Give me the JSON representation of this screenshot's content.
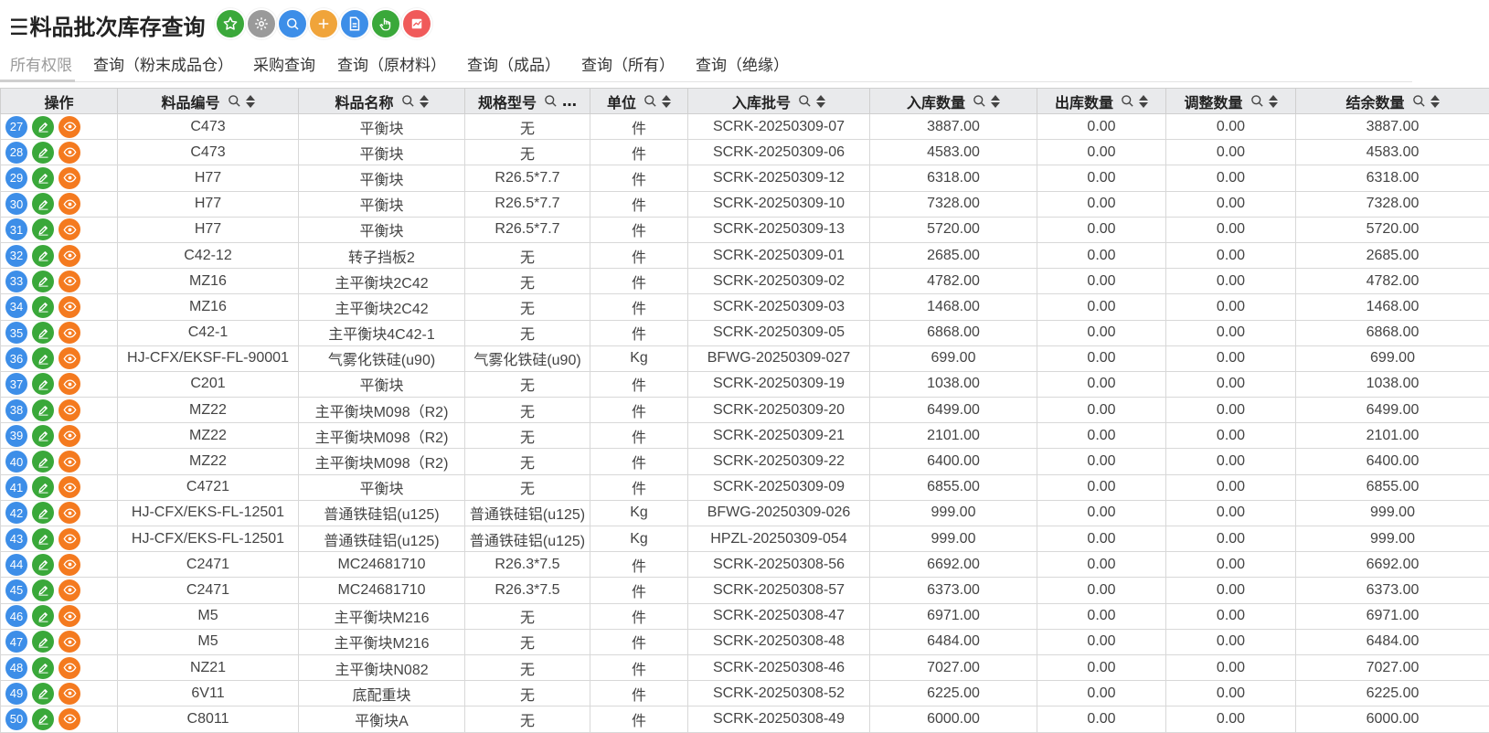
{
  "title": "料品批次库存查询",
  "toolbar": {
    "buttons": [
      {
        "name": "favorite",
        "icon": "star-icon",
        "color": "#3aa83a"
      },
      {
        "name": "settings",
        "icon": "gear-icon",
        "color": "#9a9a9a"
      },
      {
        "name": "search",
        "icon": "search-icon",
        "color": "#3d8ee8"
      },
      {
        "name": "add",
        "icon": "plus-icon",
        "color": "#f0a43a"
      },
      {
        "name": "document",
        "icon": "document-icon",
        "color": "#3d8ee8"
      },
      {
        "name": "touch",
        "icon": "hand-pointer-icon",
        "color": "#3aa83a"
      },
      {
        "name": "chart",
        "icon": "chart-icon",
        "color": "#f05a5a"
      }
    ]
  },
  "tabs": [
    {
      "label": "所有权限",
      "active": true
    },
    {
      "label": "查询（粉末成品仓）"
    },
    {
      "label": "采购查询"
    },
    {
      "label": "查询（原材料）"
    },
    {
      "label": "查询（成品）"
    },
    {
      "label": "查询（所有）"
    },
    {
      "label": "查询（绝缘）"
    }
  ],
  "table": {
    "columns": [
      "操作",
      "料品编号",
      "料品名称",
      "规格型号",
      "单位",
      "入库批号",
      "入库数量",
      "出库数量",
      "调整数量",
      "结余数量"
    ],
    "spec_header_ellipsis": "…",
    "rows": [
      {
        "no": "27",
        "code": "C473",
        "name": "平衡块",
        "spec": "无",
        "unit": "件",
        "batch": "SCRK-20250309-07",
        "in": "3887.00",
        "out": "0.00",
        "adj": "0.00",
        "bal": "3887.00"
      },
      {
        "no": "28",
        "code": "C473",
        "name": "平衡块",
        "spec": "无",
        "unit": "件",
        "batch": "SCRK-20250309-06",
        "in": "4583.00",
        "out": "0.00",
        "adj": "0.00",
        "bal": "4583.00"
      },
      {
        "no": "29",
        "code": "H77",
        "name": "平衡块",
        "spec": "R26.5*7.7",
        "unit": "件",
        "batch": "SCRK-20250309-12",
        "in": "6318.00",
        "out": "0.00",
        "adj": "0.00",
        "bal": "6318.00"
      },
      {
        "no": "30",
        "code": "H77",
        "name": "平衡块",
        "spec": "R26.5*7.7",
        "unit": "件",
        "batch": "SCRK-20250309-10",
        "in": "7328.00",
        "out": "0.00",
        "adj": "0.00",
        "bal": "7328.00"
      },
      {
        "no": "31",
        "code": "H77",
        "name": "平衡块",
        "spec": "R26.5*7.7",
        "unit": "件",
        "batch": "SCRK-20250309-13",
        "in": "5720.00",
        "out": "0.00",
        "adj": "0.00",
        "bal": "5720.00"
      },
      {
        "no": "32",
        "code": "C42-12",
        "name": "转子挡板2",
        "spec": "无",
        "unit": "件",
        "batch": "SCRK-20250309-01",
        "in": "2685.00",
        "out": "0.00",
        "adj": "0.00",
        "bal": "2685.00"
      },
      {
        "no": "33",
        "code": "MZ16",
        "name": "主平衡块2C42",
        "spec": "无",
        "unit": "件",
        "batch": "SCRK-20250309-02",
        "in": "4782.00",
        "out": "0.00",
        "adj": "0.00",
        "bal": "4782.00"
      },
      {
        "no": "34",
        "code": "MZ16",
        "name": "主平衡块2C42",
        "spec": "无",
        "unit": "件",
        "batch": "SCRK-20250309-03",
        "in": "1468.00",
        "out": "0.00",
        "adj": "0.00",
        "bal": "1468.00"
      },
      {
        "no": "35",
        "code": "C42-1",
        "name": "主平衡块4C42-1",
        "spec": "无",
        "unit": "件",
        "batch": "SCRK-20250309-05",
        "in": "6868.00",
        "out": "0.00",
        "adj": "0.00",
        "bal": "6868.00"
      },
      {
        "no": "36",
        "code": "HJ-CFX/EKSF-FL-90001",
        "name": "气雾化铁硅(u90)",
        "spec": "气雾化铁硅(u90)",
        "unit": "Kg",
        "batch": "BFWG-20250309-027",
        "in": "699.00",
        "out": "0.00",
        "adj": "0.00",
        "bal": "699.00"
      },
      {
        "no": "37",
        "code": "C201",
        "name": "平衡块",
        "spec": "无",
        "unit": "件",
        "batch": "SCRK-20250309-19",
        "in": "1038.00",
        "out": "0.00",
        "adj": "0.00",
        "bal": "1038.00"
      },
      {
        "no": "38",
        "code": "MZ22",
        "name": "主平衡块M098（R2)",
        "spec": "无",
        "unit": "件",
        "batch": "SCRK-20250309-20",
        "in": "6499.00",
        "out": "0.00",
        "adj": "0.00",
        "bal": "6499.00"
      },
      {
        "no": "39",
        "code": "MZ22",
        "name": "主平衡块M098（R2)",
        "spec": "无",
        "unit": "件",
        "batch": "SCRK-20250309-21",
        "in": "2101.00",
        "out": "0.00",
        "adj": "0.00",
        "bal": "2101.00"
      },
      {
        "no": "40",
        "code": "MZ22",
        "name": "主平衡块M098（R2)",
        "spec": "无",
        "unit": "件",
        "batch": "SCRK-20250309-22",
        "in": "6400.00",
        "out": "0.00",
        "adj": "0.00",
        "bal": "6400.00"
      },
      {
        "no": "41",
        "code": "C4721",
        "name": "平衡块",
        "spec": "无",
        "unit": "件",
        "batch": "SCRK-20250309-09",
        "in": "6855.00",
        "out": "0.00",
        "adj": "0.00",
        "bal": "6855.00"
      },
      {
        "no": "42",
        "code": "HJ-CFX/EKS-FL-12501",
        "name": "普通铁硅铝(u125)",
        "spec": "普通铁硅铝(u125)",
        "unit": "Kg",
        "batch": "BFWG-20250309-026",
        "in": "999.00",
        "out": "0.00",
        "adj": "0.00",
        "bal": "999.00"
      },
      {
        "no": "43",
        "code": "HJ-CFX/EKS-FL-12501",
        "name": "普通铁硅铝(u125)",
        "spec": "普通铁硅铝(u125)",
        "unit": "Kg",
        "batch": "HPZL-20250309-054",
        "in": "999.00",
        "out": "0.00",
        "adj": "0.00",
        "bal": "999.00"
      },
      {
        "no": "44",
        "code": "C2471",
        "name": "MC24681710",
        "spec": "R26.3*7.5",
        "unit": "件",
        "batch": "SCRK-20250308-56",
        "in": "6692.00",
        "out": "0.00",
        "adj": "0.00",
        "bal": "6692.00"
      },
      {
        "no": "45",
        "code": "C2471",
        "name": "MC24681710",
        "spec": "R26.3*7.5",
        "unit": "件",
        "batch": "SCRK-20250308-57",
        "in": "6373.00",
        "out": "0.00",
        "adj": "0.00",
        "bal": "6373.00"
      },
      {
        "no": "46",
        "code": "M5",
        "name": "主平衡块M216",
        "spec": "无",
        "unit": "件",
        "batch": "SCRK-20250308-47",
        "in": "6971.00",
        "out": "0.00",
        "adj": "0.00",
        "bal": "6971.00"
      },
      {
        "no": "47",
        "code": "M5",
        "name": "主平衡块M216",
        "spec": "无",
        "unit": "件",
        "batch": "SCRK-20250308-48",
        "in": "6484.00",
        "out": "0.00",
        "adj": "0.00",
        "bal": "6484.00"
      },
      {
        "no": "48",
        "code": "NZ21",
        "name": "主平衡块N082",
        "spec": "无",
        "unit": "件",
        "batch": "SCRK-20250308-46",
        "in": "7027.00",
        "out": "0.00",
        "adj": "0.00",
        "bal": "7027.00"
      },
      {
        "no": "49",
        "code": "6V11",
        "name": "底配重块",
        "spec": "无",
        "unit": "件",
        "batch": "SCRK-20250308-52",
        "in": "6225.00",
        "out": "0.00",
        "adj": "0.00",
        "bal": "6225.00"
      },
      {
        "no": "50",
        "code": "C8011",
        "name": "平衡块A",
        "spec": "无",
        "unit": "件",
        "batch": "SCRK-20250308-49",
        "in": "6000.00",
        "out": "0.00",
        "adj": "0.00",
        "bal": "6000.00"
      }
    ]
  }
}
